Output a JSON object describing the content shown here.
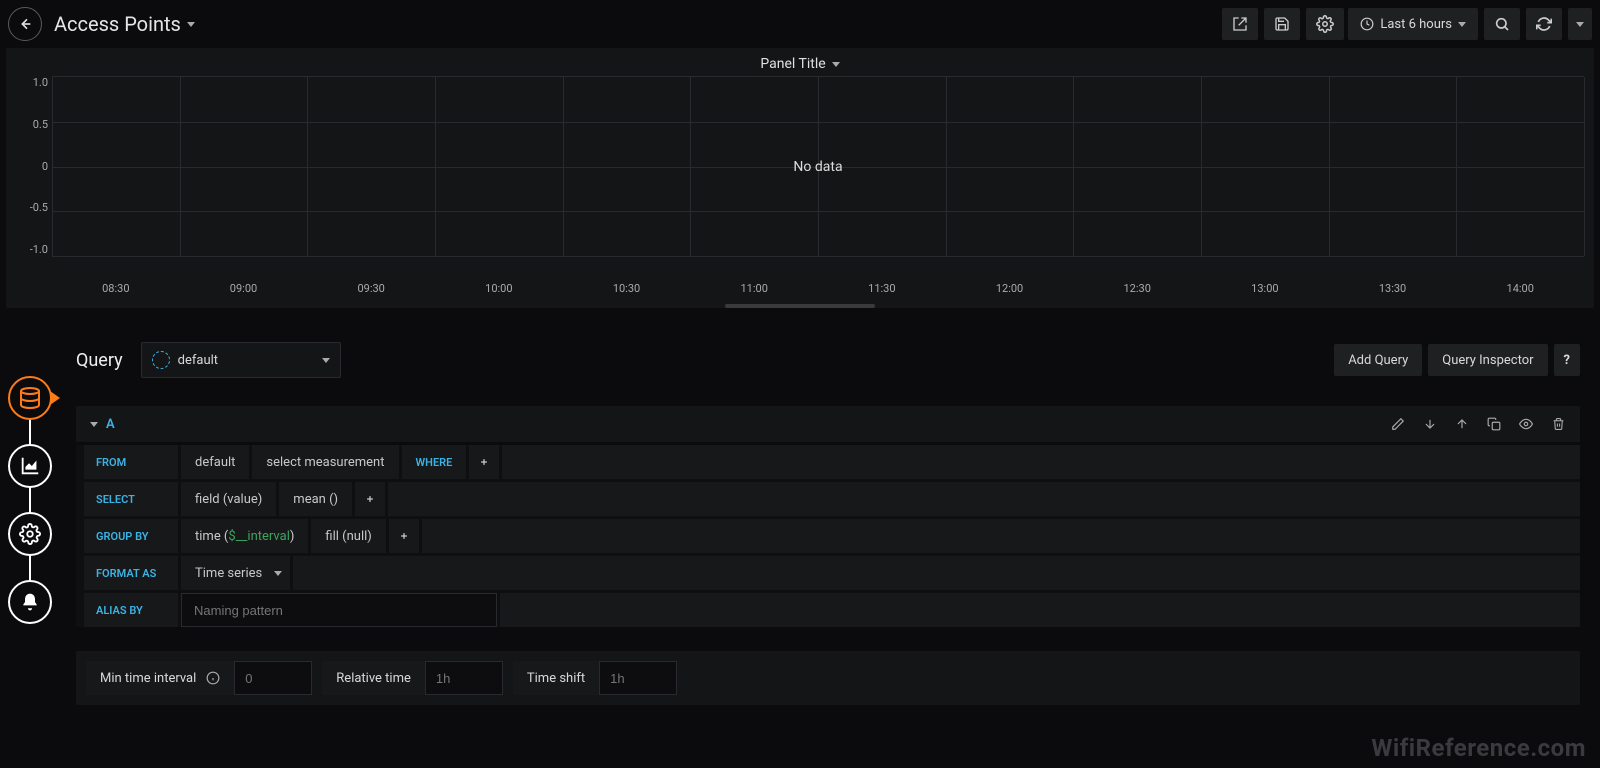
{
  "header": {
    "title": "Access Points",
    "time_range": "Last 6 hours"
  },
  "panel": {
    "title": "Panel Title",
    "no_data": "No data"
  },
  "chart_data": {
    "type": "line",
    "title": "Panel Title",
    "xlabel": "",
    "ylabel": "",
    "ylim": [
      -1.0,
      1.0
    ],
    "y_ticks": [
      "1.0",
      "0.5",
      "0",
      "-0.5",
      "-1.0"
    ],
    "x_ticks": [
      "08:30",
      "09:00",
      "09:30",
      "10:00",
      "10:30",
      "11:00",
      "11:30",
      "12:00",
      "12:30",
      "13:00",
      "13:30",
      "14:00"
    ],
    "series": []
  },
  "query": {
    "section_title": "Query",
    "datasource": "default",
    "add_query": "Add Query",
    "inspector": "Query Inspector",
    "letter": "A"
  },
  "clauses": {
    "from": "FROM",
    "from_default": "default",
    "from_measurement": "select measurement",
    "where": "WHERE",
    "select": "SELECT",
    "field_value": "field (value)",
    "mean": "mean ()",
    "group_by": "GROUP BY",
    "time_prefix": "time (",
    "time_var": "$__interval",
    "time_suffix": ")",
    "fill": "fill (null)",
    "format_as": "FORMAT AS",
    "format_value": "Time series",
    "alias_by": "ALIAS BY",
    "alias_placeholder": "Naming pattern"
  },
  "time_opts": {
    "min_interval": "Min time interval",
    "min_interval_placeholder": "0",
    "relative_time": "Relative time",
    "relative_placeholder": "1h",
    "time_shift": "Time shift",
    "shift_placeholder": "1h"
  },
  "watermark": "WifiReference.com"
}
